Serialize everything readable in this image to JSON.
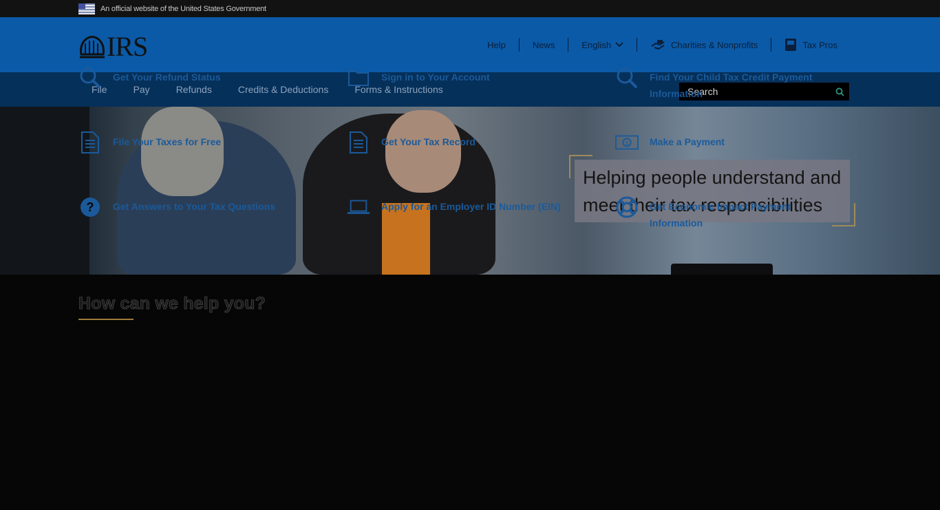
{
  "gov_banner": {
    "text": "An official website of the United States Government",
    "flag_icon": "us-flag-icon"
  },
  "header": {
    "logo_text": "IRS",
    "logo_icon": "irs-eagle-seal-icon",
    "util_nav": [
      {
        "label": "Help"
      },
      {
        "label": "News"
      },
      {
        "label": "English",
        "icon": "chevron-down-icon"
      },
      {
        "label": "Charities & Nonprofits",
        "icon": "charities-icon"
      },
      {
        "label": "Tax Pros",
        "icon": "tax-pros-icon"
      }
    ]
  },
  "main_nav": {
    "links": [
      "File",
      "Pay",
      "Refunds",
      "Credits & Deductions",
      "Forms & Instructions"
    ],
    "search": {
      "placeholder": "Search",
      "icon": "search-icon"
    }
  },
  "hero": {
    "headline_line1": "Helping people understand and",
    "headline_line2": "meet their tax responsibilities"
  },
  "help": {
    "title": "How can we help you?",
    "tiles": [
      {
        "label": "Get Your Refund Status",
        "icon": "search-icon"
      },
      {
        "label": "Sign in to Your Account",
        "icon": "folder-icon"
      },
      {
        "label": "Find Your Child Tax Credit Payment Information",
        "icon": "search-icon"
      },
      {
        "label": "File Your Taxes for Free",
        "icon": "document-icon"
      },
      {
        "label": "Get Your Tax Record",
        "icon": "document-icon"
      },
      {
        "label": "Make a Payment",
        "icon": "dollar-bill-icon"
      },
      {
        "label": "Get Answers to Your Tax Questions",
        "icon": "question-icon"
      },
      {
        "label": "Apply for an Employer ID Number (EIN)",
        "icon": "laptop-icon"
      },
      {
        "label": "Get Economic Impact Payment Information",
        "icon": "life-ring-icon"
      }
    ]
  },
  "colors": {
    "header_blue": "#0b5aa8",
    "nav_blue": "#05305a",
    "link_blue": "#1b5a9a",
    "accent_gold": "#a07b3c"
  }
}
